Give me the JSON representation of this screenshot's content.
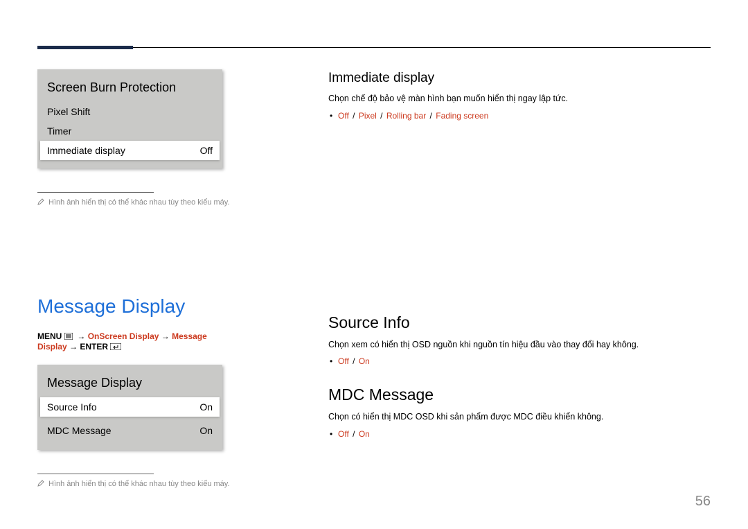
{
  "panel1": {
    "title": "Screen Burn Protection",
    "rows": [
      {
        "label": "Pixel Shift",
        "value": ""
      },
      {
        "label": "Timer",
        "value": ""
      },
      {
        "label": "Immediate display",
        "value": "Off"
      }
    ]
  },
  "note_text": "Hình ảnh hiển thị có thể khác nhau tùy theo kiểu máy.",
  "section_title": "Message Display",
  "breadcrumb": {
    "menu": "MENU",
    "p1": "OnScreen Display",
    "p2": "Message Display",
    "enter": "ENTER"
  },
  "panel2": {
    "title": "Message Display",
    "rows": [
      {
        "label": "Source Info",
        "value": "On"
      },
      {
        "label": "MDC Message",
        "value": "On"
      }
    ]
  },
  "right": {
    "immediate_display": {
      "heading": "Immediate display",
      "desc": "Chọn chế độ bảo vệ màn hình bạn muốn hiển thị ngay lập tức.",
      "opts": [
        "Off",
        "Pixel",
        "Rolling bar",
        "Fading screen"
      ]
    },
    "source_info": {
      "heading": "Source Info",
      "desc": "Chọn xem có hiển thị OSD nguồn khi nguồn tín hiệu đầu vào thay đổi hay không.",
      "opts": [
        "Off",
        "On"
      ]
    },
    "mdc_message": {
      "heading": "MDC Message",
      "desc": "Chọn có hiển thị MDC OSD khi sản phẩm được MDC điều khiển không.",
      "opts": [
        "Off",
        "On"
      ]
    }
  },
  "page_number": "56"
}
